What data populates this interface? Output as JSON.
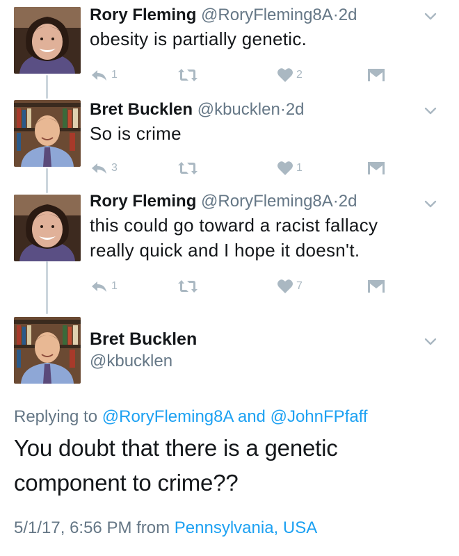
{
  "thread": [
    {
      "name": "Rory Fleming",
      "handle": "@RoryFleming8A",
      "separator": "·",
      "age": "2d",
      "text_lines": [
        "obesity is partially genetic."
      ],
      "reply_count": "1",
      "retweet_count": "",
      "like_count": "2"
    },
    {
      "name": "Bret Bucklen",
      "handle": "@kbucklen",
      "separator": "·",
      "age": "2d",
      "text_lines": [
        "So is crime"
      ],
      "reply_count": "3",
      "retweet_count": "",
      "like_count": "1"
    },
    {
      "name": "Rory Fleming",
      "handle": "@RoryFleming8A",
      "separator": "·",
      "age": "2d",
      "text_lines": [
        "this could go toward a racist fallacy",
        "really quick and I hope it doesn't."
      ],
      "reply_count": "1",
      "retweet_count": "",
      "like_count": "7"
    }
  ],
  "main_tweet": {
    "name": "Bret Bucklen",
    "handle": "@kbucklen",
    "replying_prefix": "Replying to",
    "replying_to_1": "@RoryFleming8A",
    "replying_and": "and",
    "replying_to_2": "@JohnFPfaff",
    "text_lines": [
      "You doubt that there is a genetic",
      "component to crime??"
    ],
    "timestamp": "5/1/17, 6:56 PM",
    "from_label": "from",
    "location": "Pennsylvania, USA"
  },
  "colors": {
    "text": "#14171a",
    "muted": "#657786",
    "link": "#1da1f2",
    "icon": "#aab8c2",
    "thread_line": "#ccd6dd"
  },
  "icons": [
    "reply-icon",
    "retweet-icon",
    "like-icon",
    "direct-message-icon",
    "chevron-down-icon"
  ]
}
